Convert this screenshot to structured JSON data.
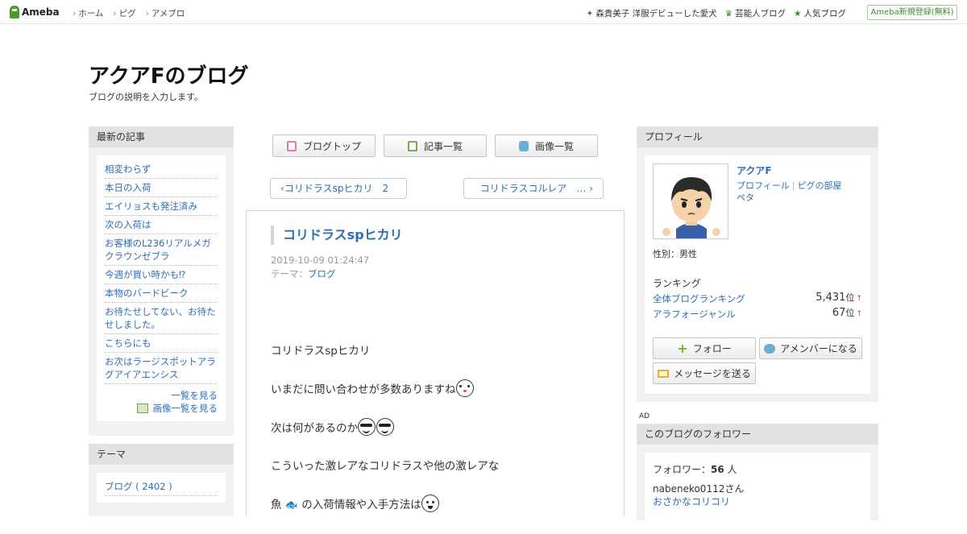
{
  "header": {
    "logo_text": "Ameba",
    "nav": [
      "ホーム",
      "ピグ",
      "アメブロ"
    ],
    "links": [
      {
        "icon": "sparkle-icon",
        "label": "森貴美子 洋服デビューした愛犬"
      },
      {
        "icon": "crown-icon",
        "label": "芸能人ブログ"
      },
      {
        "icon": "star-icon",
        "label": "人気ブログ"
      }
    ],
    "register_label": "Ameba新規登録(無料)"
  },
  "blog": {
    "title": "アクアFのブログ",
    "description": "ブログの説明を入力します。"
  },
  "sidebar_left": {
    "news_heading": "最新の記事",
    "news": [
      "相変わらず",
      "本日の入荷",
      "エイリョスも発注済み",
      "次の入荷は",
      "お客様のL236リアルメガクラウンゼブラ",
      "今週が買い時かも⁉",
      "本物のバードビーク",
      "お待たせしてない、お待たせしました。",
      "こちらにも",
      "お次はラージスポットアラグアイアエンシス"
    ],
    "more_label": "一覧を見る",
    "images_label": "画像一覧を見る",
    "theme_heading": "テーマ",
    "theme_item": "ブログ ( 2402 )"
  },
  "tabs": [
    "ブログトップ",
    "記事一覧",
    "画像一覧"
  ],
  "pager": {
    "prev": "コリドラスspヒカリ　2",
    "next": "コリドラスコルレア　…"
  },
  "article": {
    "title": "コリドラスspヒカリ",
    "date": "2019-10-09 01:24:47",
    "theme_label": "テーマ：",
    "theme_value": "ブログ",
    "lines": [
      "コリドラスspヒカリ",
      "いまだに問い合わせが多数ありますね",
      "次は何があるのか",
      "こういった激レアなコリドラスや他の激レアな",
      "魚",
      "の入荷情報や入手方法は"
    ]
  },
  "profile": {
    "heading": "プロフィール",
    "name": "アクアF",
    "link_profile": "プロフィール",
    "link_pig": "ピグの部屋",
    "link_peta": "ペタ",
    "gender": "性別：男性",
    "ranking_heading": "ランキング",
    "ranks": [
      {
        "label": "全体ブログランキング",
        "value": "5,431",
        "unit": "位"
      },
      {
        "label": "アラフォージャンル",
        "value": "67",
        "unit": "位"
      }
    ],
    "follow_label": "フォロー",
    "member_label": "アメンバーになる",
    "message_label": "メッセージを送る"
  },
  "ad_label": "AD",
  "followers": {
    "heading": "このブログのフォロワー",
    "count_label": "フォロワー：",
    "count": "56",
    "count_unit": " 人",
    "user": "nabeneko0112さん",
    "user_blog": "おさかなコリコリ"
  },
  "colors": {
    "link": "#2d6db5",
    "brand_green": "#4b9b2f",
    "side_bg": "#f1f1f1",
    "side_head": "#e2e2e2"
  }
}
